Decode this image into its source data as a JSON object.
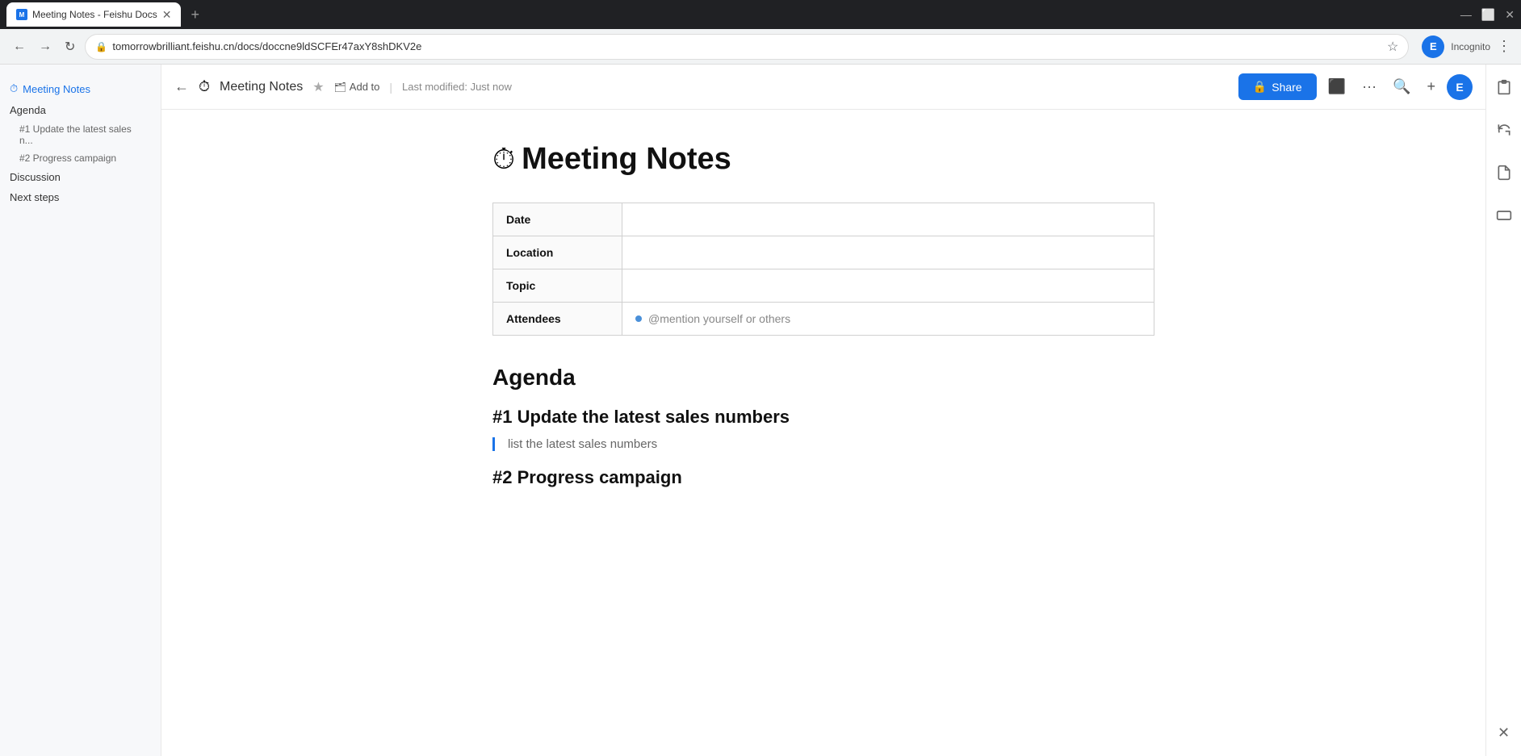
{
  "browser": {
    "tab_title": "Meeting Notes - Feishu Docs",
    "url": "tomorrowbrilliant.feishu.cn/docs/doccne9ldSCFEr47axY8shDKV2e",
    "profile_label": "Incognito",
    "profile_initial": "E"
  },
  "header": {
    "doc_icon": "⏱",
    "doc_title": "Meeting Notes",
    "star_label": "★",
    "add_to_label": "Add to",
    "modified_label": "Last modified: Just now",
    "share_label": "Share",
    "back_label": "←"
  },
  "sidebar": {
    "meeting_notes_label": "Meeting Notes",
    "agenda_label": "Agenda",
    "agenda_item1": "#1 Update the latest sales n...",
    "agenda_item2": "#2 Progress campaign",
    "discussion_label": "Discussion",
    "next_steps_label": "Next steps"
  },
  "doc": {
    "title_icon": "⏱",
    "title": "Meeting Notes",
    "table": {
      "rows": [
        {
          "label": "Date",
          "value": ""
        },
        {
          "label": "Location",
          "value": ""
        },
        {
          "label": "Topic",
          "value": ""
        },
        {
          "label": "Attendees",
          "value": "@mention yourself or others",
          "is_placeholder": true
        }
      ]
    },
    "agenda_heading": "Agenda",
    "item1_heading": "#1 Update the latest sales numbers",
    "item1_body": "list the latest sales numbers",
    "item2_heading": "#2 Progress campaign"
  },
  "right_panel": {
    "icon1": "📋",
    "icon2": "🔄",
    "icon3": "📄",
    "icon4": "⌨"
  }
}
